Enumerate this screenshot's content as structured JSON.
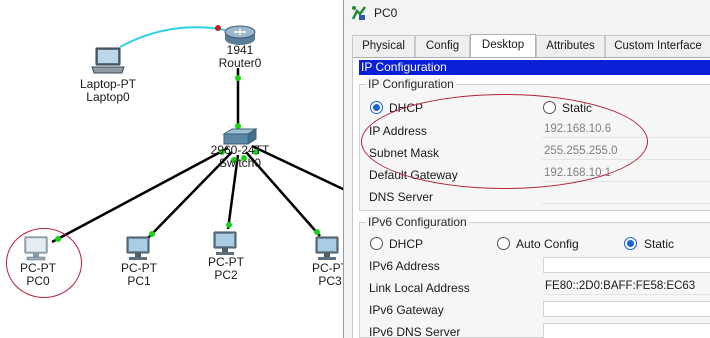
{
  "topology": {
    "devices": {
      "laptop": {
        "type": "Laptop-PT",
        "name": "Laptop0"
      },
      "router": {
        "type": "1941",
        "name": "Router0"
      },
      "switch": {
        "type": "2960-24TT",
        "name": "Switch0"
      },
      "pc0": {
        "type": "PC-PT",
        "name": "PC0"
      },
      "pc1": {
        "type": "PC-PT",
        "name": "PC1"
      },
      "pc2": {
        "type": "PC-PT",
        "name": "PC2"
      },
      "pc3": {
        "type": "PC-PT",
        "name": "PC3"
      }
    },
    "colors": {
      "link": "#000000",
      "wireless_link": "#2fd0e8",
      "port_up": "#19d119",
      "highlight_ellipse": "#b0243a"
    }
  },
  "window": {
    "title": "PC0",
    "tabs": [
      {
        "label": "Physical",
        "active": false
      },
      {
        "label": "Config",
        "active": false
      },
      {
        "label": "Desktop",
        "active": true
      },
      {
        "label": "Attributes",
        "active": false
      },
      {
        "label": "Custom Interface",
        "active": false
      }
    ],
    "header": "IP Configuration",
    "ipv4": {
      "section_title": "IP Configuration",
      "dhcp_label": "DHCP",
      "static_label": "Static",
      "mode": "DHCP",
      "ip_label": "IP Address",
      "ip_value": "192.168.10.6",
      "mask_label": "Subnet Mask",
      "mask_value": "255.255.255.0",
      "gateway_label": "Default Gateway",
      "gateway_value": "192.168.10.1",
      "dns_label": "DNS Server",
      "dns_value": ""
    },
    "ipv6": {
      "section_title": "IPv6 Configuration",
      "dhcp_label": "DHCP",
      "auto_label": "Auto Config",
      "static_label": "Static",
      "mode": "Static",
      "address_label": "IPv6 Address",
      "address_value": "",
      "link_local_label": "Link Local Address",
      "link_local_value": "FE80::2D0:BAFF:FE58:EC63",
      "gateway_label": "IPv6 Gateway",
      "gateway_value": "",
      "dns_label": "IPv6 DNS Server",
      "dns_value": ""
    },
    "colors": {
      "header_bg": "#0a1fd6",
      "radio_selected": "#1b62d1"
    }
  }
}
